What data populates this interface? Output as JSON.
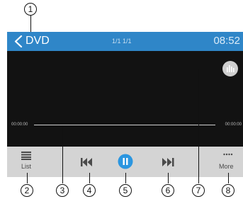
{
  "header": {
    "title": "DVD",
    "track_info": "1/1   1/1",
    "clock": "08:52"
  },
  "playback": {
    "elapsed": "00:00:00",
    "total": "00:00:00"
  },
  "toolbar": {
    "list_label": "List",
    "more_label": "More"
  },
  "callouts": [
    "1",
    "2",
    "3",
    "4",
    "5",
    "6",
    "7",
    "8"
  ],
  "colors": {
    "header_bar": "#2f86c8",
    "screen_bg": "#121212",
    "toolbar_bg": "#d4d4d4",
    "play_accent": "#2b96e0"
  },
  "icons": {
    "back": "chevron-left-icon",
    "equalizer": "equalizer-icon",
    "list": "list-icon",
    "previous": "skip-previous-icon",
    "pause": "pause-icon",
    "next": "skip-next-icon",
    "more": "more-dots-icon"
  }
}
